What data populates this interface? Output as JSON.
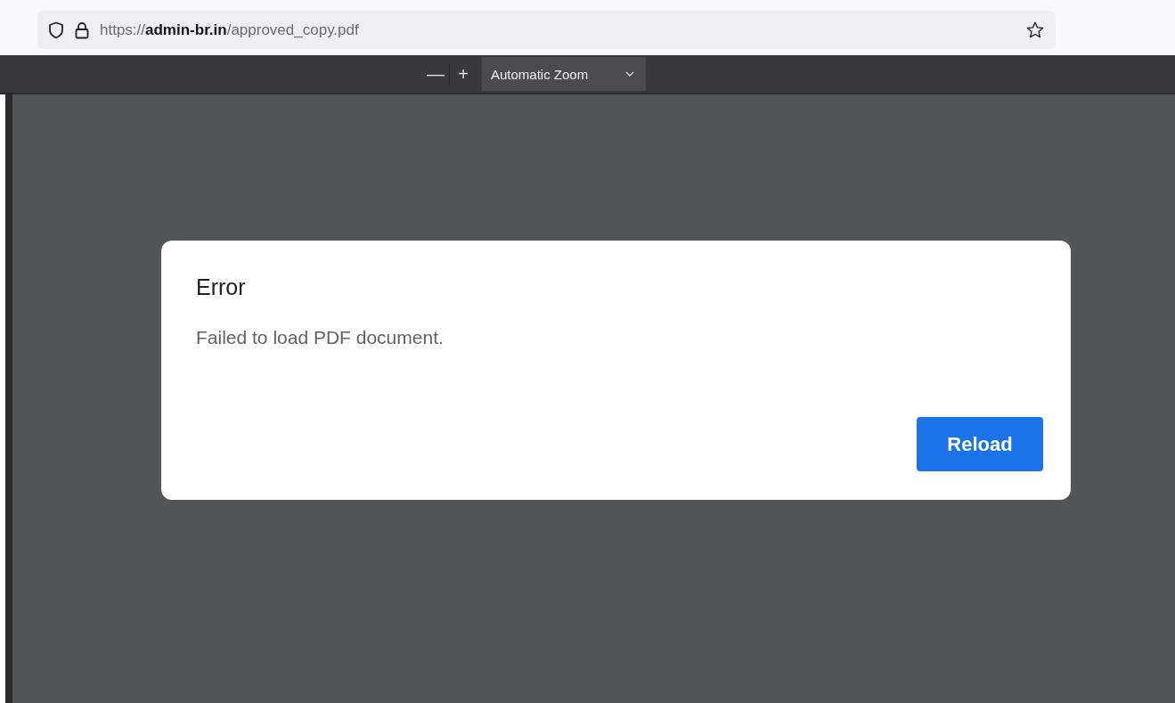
{
  "address_bar": {
    "url": "https://**admin-br.in**/approved_copy.pdf"
  },
  "pdf_toolbar": {
    "zoom_out": "—",
    "zoom_in": "+",
    "zoom_select": "Automatic Zoom"
  },
  "dialog": {
    "title": "Error",
    "message": "Failed to load PDF document.",
    "button": "Reload"
  }
}
